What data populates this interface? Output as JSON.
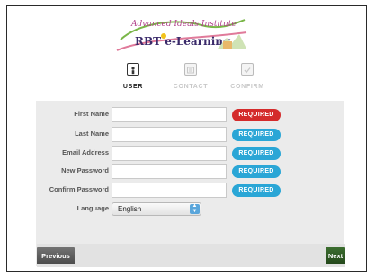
{
  "logo": {
    "line1": "Advanced Ideals Institute",
    "line2": "RBT e-Learning"
  },
  "steps": [
    {
      "label": "USER",
      "active": true,
      "icon": "user-icon"
    },
    {
      "label": "CONTACT",
      "active": false,
      "icon": "contact-card-icon"
    },
    {
      "label": "CONFIRM",
      "active": false,
      "icon": "checkmark-icon"
    }
  ],
  "form": {
    "first_name": {
      "label": "First Name",
      "value": "",
      "badge": "REQUIRED"
    },
    "last_name": {
      "label": "Last Name",
      "value": "",
      "badge": "REQUIRED"
    },
    "email": {
      "label": "Email Address",
      "value": "",
      "badge": "REQUIRED"
    },
    "new_password": {
      "label": "New Password",
      "value": "",
      "badge": "REQUIRED"
    },
    "confirm_password": {
      "label": "Confirm Password",
      "value": "",
      "badge": "REQUIRED"
    },
    "language": {
      "label": "Language",
      "value": "English"
    }
  },
  "colors": {
    "required_red": "#d42b2b",
    "required_blue": "#2aa6d6",
    "next_green": "#2f5a25"
  },
  "nav": {
    "previous": "Previous",
    "next": "Next"
  }
}
